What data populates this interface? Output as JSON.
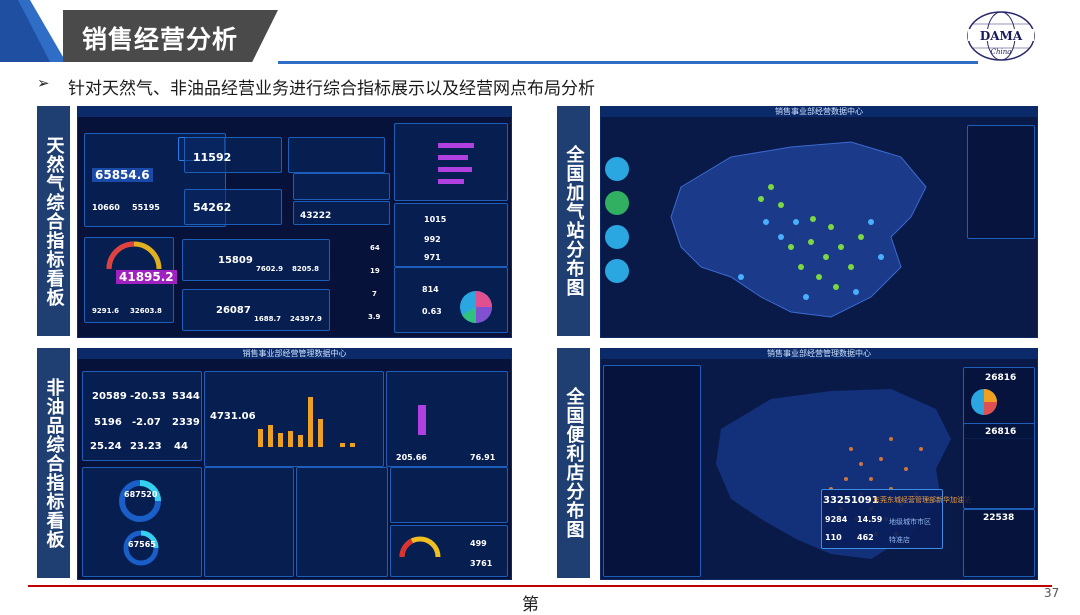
{
  "slide": {
    "title": "销售经营分析",
    "subtitle": "针对天然气、非油品经营业务进行综合指标展示以及经营网点布局分析",
    "page_number": "37",
    "footer_char": "第",
    "logo_text": "DAMA China"
  },
  "sections": [
    {
      "label": "天然气综合指标看板"
    },
    {
      "label": "全国加气站分布图"
    },
    {
      "label": "非油品综合指标看板"
    },
    {
      "label": "全国便利店分布图"
    }
  ],
  "screenshots": {
    "gas": {
      "kpis": [
        "65854.6",
        "11592",
        "54262",
        "43222",
        "41895.2",
        "15809",
        "26087",
        "1015",
        "992",
        "971",
        "814",
        "0.63",
        "10660",
        "55195",
        "9291.6",
        "32603.8",
        "7602.9",
        "8205.8",
        "1688.7",
        "24397.9",
        "64",
        "19",
        "7",
        "3.9"
      ]
    },
    "station_map": {
      "title": "销售事业部经营数据中心"
    },
    "nonoil": {
      "title": "销售事业部经营管理数据中心",
      "kpis": [
        "20589",
        "-20.53",
        "5344",
        "5196",
        "-2.07",
        "2339",
        "25.24",
        "23.23",
        "44",
        "4731.06",
        "687520",
        "67565",
        "205.66",
        "76.91",
        "499",
        "3761"
      ]
    },
    "store_map": {
      "title": "销售事业部经营管理数据中心",
      "kpis": [
        "33251091",
        "9284",
        "14.59",
        "110",
        "462",
        "26816",
        "26816",
        "22538"
      ],
      "labels": [
        "东莞东城经营管理部新华加油站",
        "地级城市市区",
        "特准店"
      ]
    }
  },
  "colors": {
    "label_bg": "#1f3f73",
    "accent_line": "#2f6dc6",
    "footer_line": "#c00000"
  }
}
